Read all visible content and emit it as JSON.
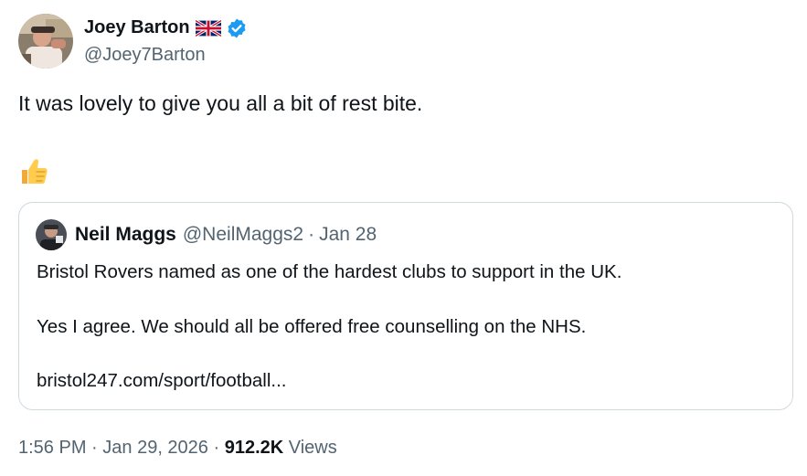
{
  "author": {
    "display_name": "Joey Barton",
    "handle": "@Joey7Barton",
    "flag_icon": "uk-flag-icon",
    "verified_icon": "verified-badge-icon",
    "verified_color": "#1d9bf0"
  },
  "tweet": {
    "text": "It was lovely to give you all a bit of rest bite.",
    "emoji": "thumbs-up-icon"
  },
  "quoted_tweet": {
    "display_name": "Neil Maggs",
    "handle": "@NeilMaggs2",
    "separator": "·",
    "date": "Jan 28",
    "lines": [
      "Bristol Rovers named as one of the hardest clubs to support in the UK.",
      "Yes I agree. We should all be offered free counselling on the NHS.",
      "bristol247.com/sport/football..."
    ]
  },
  "meta": {
    "time": "1:56 PM",
    "sep1": " · ",
    "date": "Jan 29, 2026",
    "sep2": " · ",
    "views_count": "912.2K",
    "views_label": " Views"
  },
  "colors": {
    "text_primary": "#0f1419",
    "text_secondary": "#536471",
    "border": "#cfd9de",
    "accent": "#1d9bf0"
  }
}
